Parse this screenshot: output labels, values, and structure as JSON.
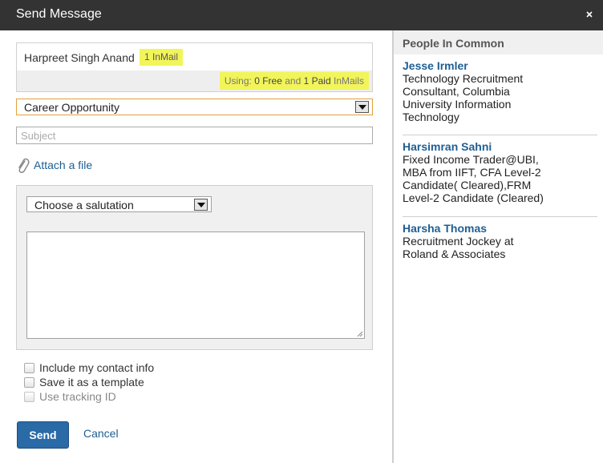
{
  "window": {
    "title": "Send Message"
  },
  "recipient": {
    "name": "Harpreet Singh Anand",
    "inmail_tag": "1 InMail",
    "usage": {
      "prefix": "Using:",
      "free": "0 Free",
      "and": "and",
      "paid": "1 Paid",
      "suffix": "InMails"
    }
  },
  "category_select": {
    "selected": "Career Opportunity"
  },
  "subject": {
    "value": "",
    "placeholder": "Subject"
  },
  "attach": {
    "label": "Attach a file"
  },
  "salutation_select": {
    "selected": "Choose a salutation"
  },
  "message": {
    "value": ""
  },
  "options": [
    {
      "label": "Include my contact info",
      "checked": false,
      "enabled": true
    },
    {
      "label": "Save it as a template",
      "checked": false,
      "enabled": true
    },
    {
      "label": "Use tracking ID",
      "checked": false,
      "enabled": false
    }
  ],
  "actions": {
    "send_label": "Send",
    "cancel_label": "Cancel"
  },
  "people_in_common": {
    "heading": "People In Common",
    "people": [
      {
        "name": "Jesse Irmler",
        "headline": [
          "Technology Recruitment",
          "Consultant, Columbia",
          "University Information",
          "Technology"
        ]
      },
      {
        "name": "Harsimran Sahni",
        "headline": [
          "Fixed Income Trader@UBI,",
          "MBA from IIFT, CFA Level-2",
          "Candidate( Cleared),FRM",
          "Level-2 Candidate (Cleared)"
        ]
      },
      {
        "name": "Harsha Thomas",
        "headline": [
          "Recruitment Jockey at",
          "Roland & Associates"
        ]
      }
    ]
  },
  "colors": {
    "titlebar": "#333333",
    "link": "#1e5e93",
    "highlight": "#f2f55a",
    "send_button": "#2a6aa6"
  }
}
